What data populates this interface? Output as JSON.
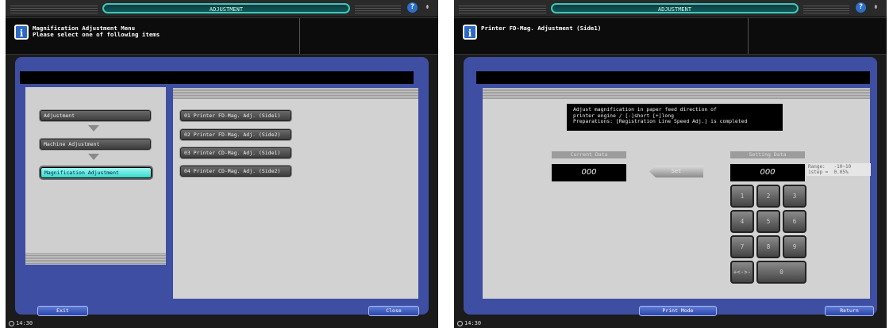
{
  "left": {
    "header": {
      "title": "ADJUSTMENT"
    },
    "message": "Magnification Adjustment Menu\nPlease select one of following items",
    "tree": [
      "Adjustment",
      "Machine Adjustment",
      "Magnification Adjustment"
    ],
    "menu": [
      "01 Printer FD-Mag. Adj. (Side1)",
      "02 Printer FD-Mag. Adj. (Side2)",
      "03 Printer CD-Mag. Adj. (Side1)",
      "04 Printer CD-Mag. Adj. (Side2)"
    ],
    "buttons": {
      "exit": "Exit",
      "close": "Close"
    },
    "clock": "14:30"
  },
  "right": {
    "header": {
      "title": "ADJUSTMENT"
    },
    "message": "Printer FD-Mag. Adjustment (Side1)",
    "description": "Adjust magnification in paper feed direction of\nprinter engine / [-]short [+]long\nPreparations: [Registration Line Speed Adj.] is completed",
    "current_label": "Current Data",
    "current_value": "000",
    "set_label": "Set",
    "setting_label": "Setting Data",
    "setting_value": "000",
    "range": "Range:   -10~10\n1step =  0.05%",
    "keys": [
      "1",
      "2",
      "3",
      "4",
      "5",
      "6",
      "7",
      "8",
      "9",
      "+<->-",
      "0"
    ],
    "buttons": {
      "print_mode": "Print Mode",
      "return": "Return"
    },
    "clock": "14:30"
  },
  "icons": {
    "help": "question-icon",
    "pin": "pushpin-icon",
    "info": "info-icon",
    "clock": "clock-icon"
  },
  "colors": {
    "frame": "#3e4ea2",
    "highlight": "#38d8cc",
    "button": "#2c46a6"
  }
}
